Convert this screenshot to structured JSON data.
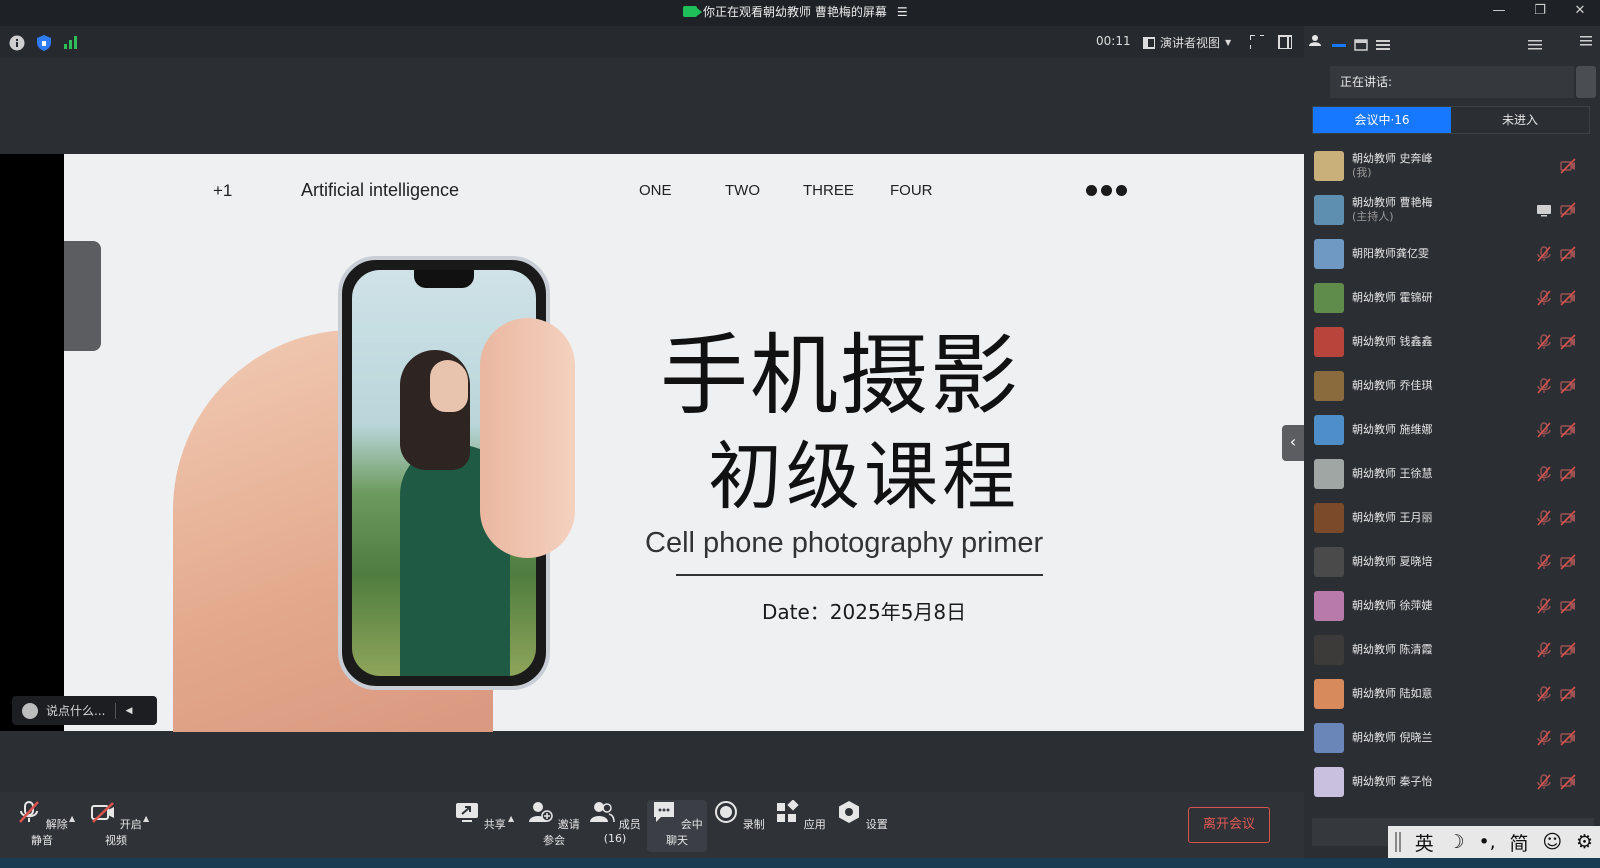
{
  "titlebar": {
    "title": "你正在观看朝幼教师 曹艳梅的屏幕",
    "menu_glyph": "☰",
    "minimize": "—",
    "restore": "❐",
    "close": "✕"
  },
  "infobar": {
    "timer": "00:11",
    "view_mode": "演讲者视图"
  },
  "slide": {
    "badge": "+1",
    "brand": "Artificial intelligence",
    "nav": [
      "ONE",
      "TWO",
      "THREE",
      "FOUR"
    ],
    "headline": "手机摄影",
    "subheadline": "初级课程",
    "course_en": "Cell phone photography primer",
    "date": "Date：2025年5月8日"
  },
  "chat_input": {
    "placeholder": "说点什么..."
  },
  "toolbar": {
    "unmute": "解除静音",
    "start_video": "开启视频",
    "share": "共享",
    "invite": "邀请参会",
    "members": "成员(16)",
    "chat": "会中聊天",
    "record": "录制",
    "apps": "应用",
    "settings": "设置",
    "leave": "离开会议"
  },
  "panel": {
    "speaking_label": "正在讲话:",
    "tab_in_meeting": "会议中·16",
    "tab_not_joined": "未进入",
    "members": [
      {
        "name": "朝幼教师 史奔峰",
        "role": "(我)",
        "avatar_color": "#c9b07a",
        "show_video_icon": false
      },
      {
        "name": "朝幼教师 曹艳梅",
        "role": "(主持人)",
        "avatar_color": "#5f8fb0",
        "show_video_icon": true
      },
      {
        "name": "朝阳教师龚亿雯",
        "role": "",
        "avatar_color": "#6f98c2",
        "show_video_icon": true
      },
      {
        "name": "朝幼教师 霍锦研",
        "role": "",
        "avatar_color": "#5f8c4a",
        "show_video_icon": true
      },
      {
        "name": "朝幼教师 钱鑫鑫",
        "role": "",
        "avatar_color": "#b8453c",
        "show_video_icon": true
      },
      {
        "name": "朝幼教师 乔佳琪",
        "role": "",
        "avatar_color": "#8a6b3e",
        "show_video_icon": true
      },
      {
        "name": "朝幼教师 施维娜",
        "role": "",
        "avatar_color": "#4f8fc9",
        "show_video_icon": true
      },
      {
        "name": "朝幼教师 王徐慧",
        "role": "",
        "avatar_color": "#9fa6a4",
        "show_video_icon": true
      },
      {
        "name": "朝幼教师 王月丽",
        "role": "",
        "avatar_color": "#7a4a2a",
        "show_video_icon": true
      },
      {
        "name": "朝幼教师 夏晓培",
        "role": "",
        "avatar_color": "#4a4a4a",
        "show_video_icon": true
      },
      {
        "name": "朝幼教师 徐萍婕",
        "role": "",
        "avatar_color": "#b87aa8",
        "show_video_icon": true
      },
      {
        "name": "朝幼教师 陈清霞",
        "role": "",
        "avatar_color": "#3d3a3a",
        "show_video_icon": true
      },
      {
        "name": "朝幼教师 陆如意",
        "role": "",
        "avatar_color": "#d78a5c",
        "show_video_icon": true
      },
      {
        "name": "朝幼教师 倪晓兰",
        "role": "",
        "avatar_color": "#6a86b8",
        "show_video_icon": true
      },
      {
        "name": "朝幼教师 秦子怡",
        "role": "",
        "avatar_color": "#c9c0e0",
        "show_video_icon": true
      }
    ]
  },
  "ime": {
    "lang": "英",
    "moon": "☽",
    "punct": "•,",
    "script": "简",
    "emoji": "☺",
    "gear": "⚙"
  },
  "colors": {
    "accent": "#1677ff",
    "leave_red": "#e05a54",
    "mic_off_red": "#d9534f",
    "share_green": "#1fbf5a"
  }
}
